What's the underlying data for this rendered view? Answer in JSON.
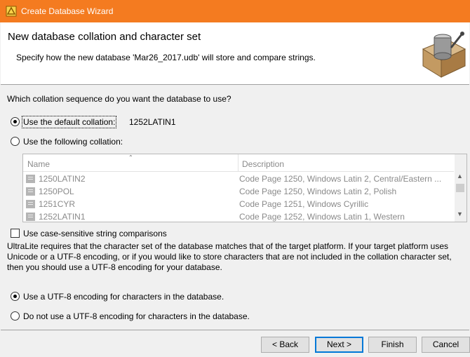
{
  "window": {
    "title": "Create Database Wizard"
  },
  "header": {
    "title": "New database collation and character set",
    "subtitle": "Specify how the new database 'Mar26_2017.udb' will store and compare strings."
  },
  "question": "Which collation sequence do you want the database to use?",
  "collation": {
    "default_option_label": "Use the default collation:",
    "default_value": "1252LATIN1",
    "following_option_label": "Use the following collation:",
    "selected": "default"
  },
  "table": {
    "columns": [
      "Name",
      "Description"
    ],
    "rows": [
      {
        "name": "1250LATIN2",
        "description": "Code Page 1250, Windows Latin 2, Central/Eastern ..."
      },
      {
        "name": "1250POL",
        "description": "Code Page 1250, Windows Latin 2, Polish"
      },
      {
        "name": "1251CYR",
        "description": "Code Page 1251, Windows Cyrillic"
      },
      {
        "name": "1252LATIN1",
        "description": "Code Page 1252, Windows Latin 1, Western"
      }
    ]
  },
  "case_sensitive": {
    "label": "Use case-sensitive string comparisons",
    "checked": false
  },
  "info_text": "UltraLite requires that the character set of the database matches that of the target platform. If your target platform uses Unicode or a UTF-8 encoding, or if you would like to store characters that are not included in the collation character set, then you should use a UTF-8 encoding for your database.",
  "encoding": {
    "use_utf8_label": "Use a UTF-8 encoding for characters in the database.",
    "no_utf8_label": "Do not use a UTF-8 encoding for characters in the database.",
    "selected": "use_utf8"
  },
  "buttons": {
    "back": "< Back",
    "next": "Next >",
    "finish": "Finish",
    "cancel": "Cancel"
  },
  "colors": {
    "titlebar": "#f47b20",
    "accent": "#0078d7"
  }
}
